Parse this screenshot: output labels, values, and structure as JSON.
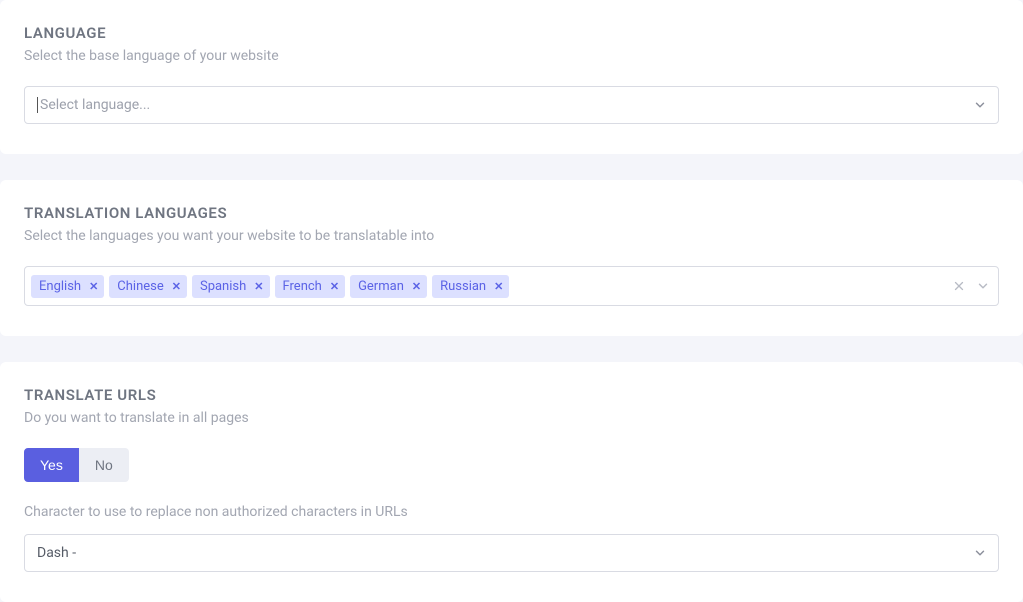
{
  "language": {
    "title": "LANGUAGE",
    "subtitle": "Select the base language of your website",
    "placeholder": "Select language..."
  },
  "translation": {
    "title": "TRANSLATION LANGUAGES",
    "subtitle": "Select the languages you want your website to be translatable into",
    "tags": [
      "English",
      "Chinese",
      "Spanish",
      "French",
      "German",
      "Russian"
    ]
  },
  "urls": {
    "title": "TRANSLATE URLS",
    "subtitle": "Do you want to translate in all pages",
    "yes": "Yes",
    "no": "No",
    "char_label": "Character to use to replace non authorized characters in URLs",
    "char_value": "Dash -"
  }
}
